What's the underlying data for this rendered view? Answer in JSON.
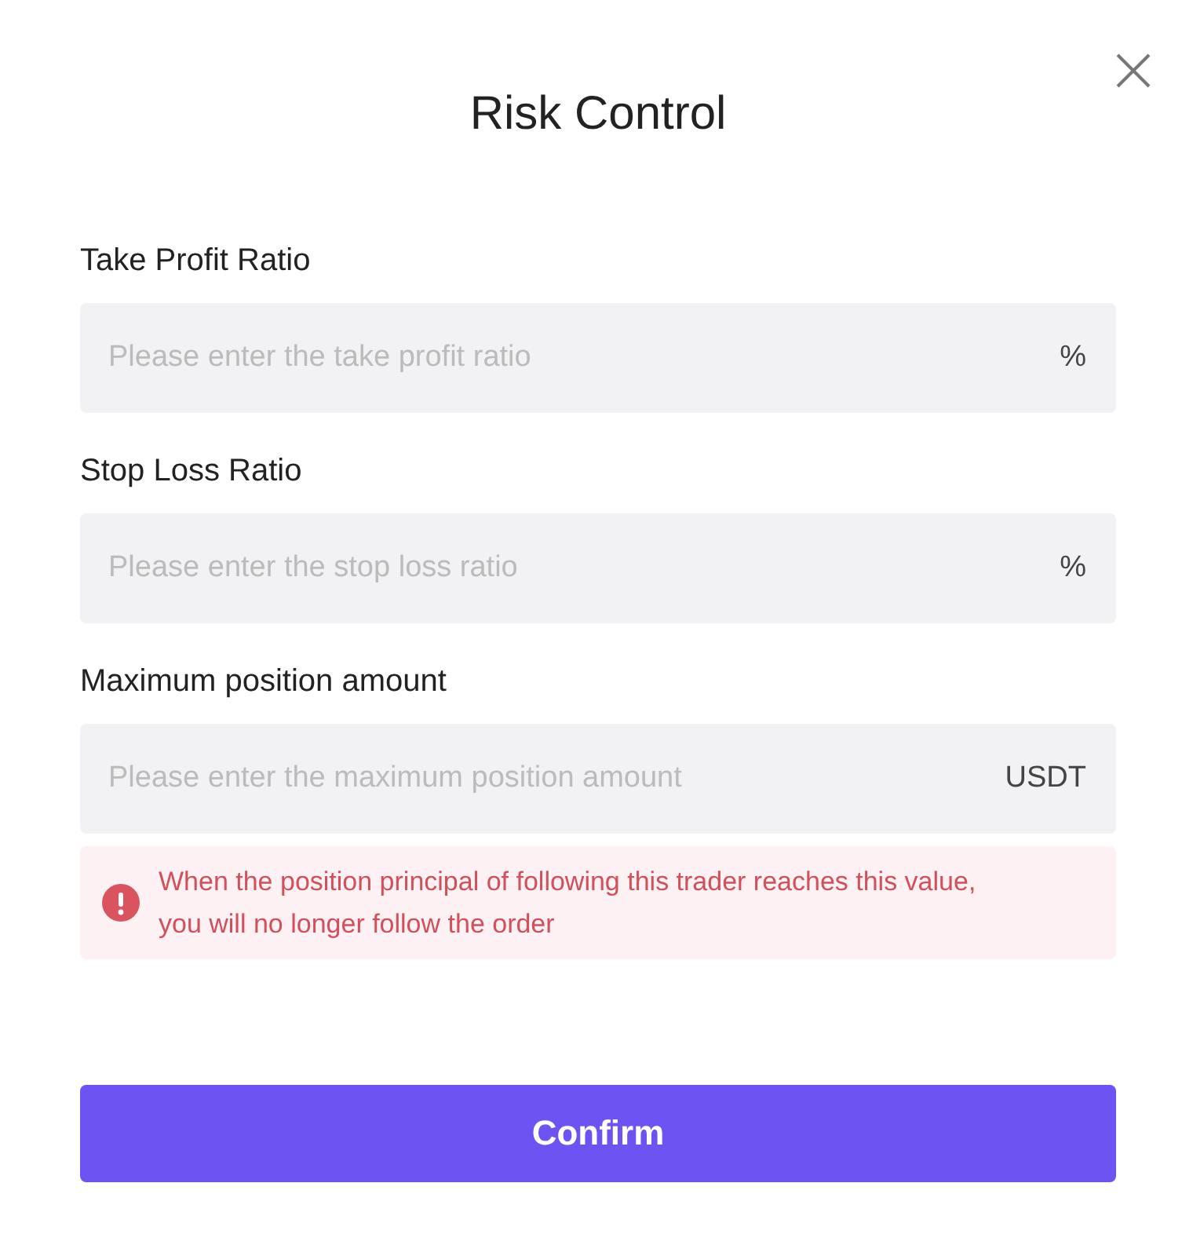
{
  "title": "Risk Control",
  "fields": [
    {
      "label": "Take Profit Ratio",
      "placeholder": "Please enter the take profit ratio",
      "unit": "%"
    },
    {
      "label": "Stop Loss Ratio",
      "placeholder": "Please enter the stop loss ratio",
      "unit": "%"
    },
    {
      "label": "Maximum position amount",
      "placeholder": "Please enter the maximum position amount",
      "unit": "USDT"
    }
  ],
  "warning": "When the position principal of following this trader reaches this value, you will no longer follow the order",
  "confirm_button": "Confirm"
}
